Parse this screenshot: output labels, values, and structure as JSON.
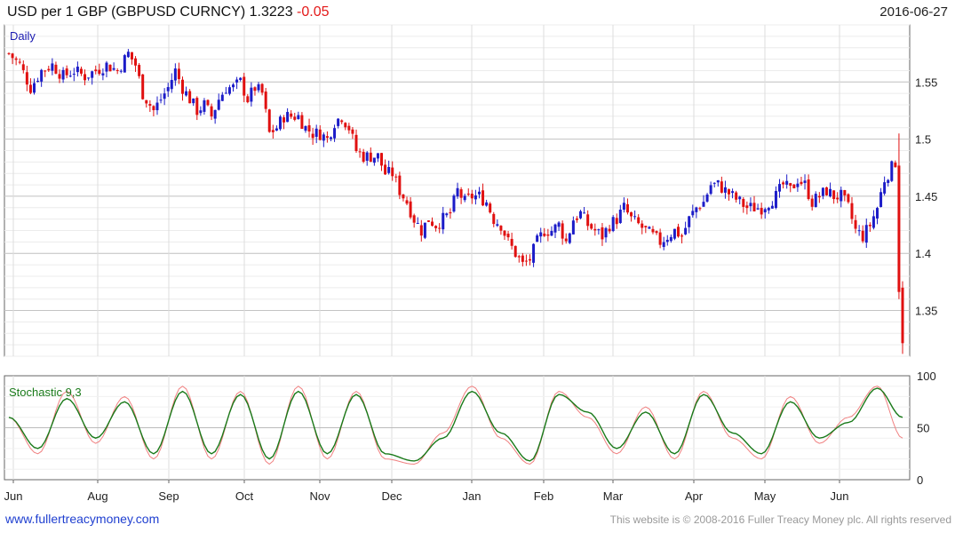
{
  "header": {
    "title": "USD per 1 GBP (GBPUSD CURNCY) 1.3223",
    "change": "-0.05",
    "date": "2016-06-27"
  },
  "footer": {
    "site": "www.fullertreacymoney.com",
    "copyright": "This website is © 2008-2016 Fuller Treacy Money plc. All rights reserved"
  },
  "colors": {
    "up": "#1c1cc8",
    "down": "#e01010",
    "stoch_k": "#f08080",
    "stoch_d": "#1a7a1a",
    "label": "#1a1ab0"
  },
  "chart_data": [
    {
      "type": "candlestick",
      "label": "Daily",
      "ylim": [
        1.31,
        1.6
      ],
      "yticks": [
        1.35,
        1.4,
        1.45,
        1.5,
        1.55
      ],
      "xticks": [
        "Jun",
        "Aug",
        "Sep",
        "Oct",
        "Nov",
        "Dec",
        "Jan",
        "Feb",
        "Mar",
        "Apr",
        "May",
        "Jun"
      ],
      "grid": true,
      "close_path": [
        [
          0,
          1.575
        ],
        [
          3,
          1.565
        ],
        [
          6,
          1.545
        ],
        [
          9,
          1.56
        ],
        [
          12,
          1.565
        ],
        [
          15,
          1.555
        ],
        [
          18,
          1.56
        ],
        [
          21,
          1.555
        ],
        [
          24,
          1.56
        ],
        [
          27,
          1.565
        ],
        [
          30,
          1.56
        ],
        [
          33,
          1.575
        ],
        [
          35,
          1.565
        ],
        [
          37,
          1.54
        ],
        [
          40,
          1.525
        ],
        [
          42,
          1.535
        ],
        [
          44,
          1.545
        ],
        [
          46,
          1.56
        ],
        [
          48,
          1.545
        ],
        [
          50,
          1.535
        ],
        [
          52,
          1.525
        ],
        [
          54,
          1.53
        ],
        [
          56,
          1.52
        ],
        [
          58,
          1.535
        ],
        [
          60,
          1.545
        ],
        [
          62,
          1.545
        ],
        [
          64,
          1.55
        ],
        [
          66,
          1.535
        ],
        [
          68,
          1.545
        ],
        [
          70,
          1.54
        ],
        [
          72,
          1.505
        ],
        [
          74,
          1.51
        ],
        [
          76,
          1.52
        ],
        [
          78,
          1.52
        ],
        [
          80,
          1.52
        ],
        [
          82,
          1.51
        ],
        [
          84,
          1.505
        ],
        [
          86,
          1.505
        ],
        [
          88,
          1.5
        ],
        [
          90,
          1.515
        ],
        [
          92,
          1.52
        ],
        [
          94,
          1.51
        ],
        [
          96,
          1.49
        ],
        [
          98,
          1.485
        ],
        [
          100,
          1.485
        ],
        [
          102,
          1.485
        ],
        [
          104,
          1.47
        ],
        [
          106,
          1.47
        ],
        [
          108,
          1.455
        ],
        [
          110,
          1.445
        ],
        [
          112,
          1.43
        ],
        [
          114,
          1.42
        ],
        [
          116,
          1.43
        ],
        [
          118,
          1.425
        ],
        [
          120,
          1.43
        ],
        [
          122,
          1.435
        ],
        [
          124,
          1.455
        ],
        [
          126,
          1.445
        ],
        [
          128,
          1.45
        ],
        [
          130,
          1.45
        ],
        [
          132,
          1.445
        ],
        [
          134,
          1.43
        ],
        [
          136,
          1.425
        ],
        [
          138,
          1.41
        ],
        [
          140,
          1.4
        ],
        [
          142,
          1.39
        ],
        [
          144,
          1.395
        ],
        [
          146,
          1.41
        ],
        [
          148,
          1.42
        ],
        [
          150,
          1.42
        ],
        [
          152,
          1.425
        ],
        [
          154,
          1.41
        ],
        [
          156,
          1.43
        ],
        [
          158,
          1.435
        ],
        [
          160,
          1.425
        ],
        [
          162,
          1.42
        ],
        [
          164,
          1.415
        ],
        [
          166,
          1.425
        ],
        [
          168,
          1.43
        ],
        [
          170,
          1.44
        ],
        [
          172,
          1.43
        ],
        [
          174,
          1.425
        ],
        [
          176,
          1.42
        ],
        [
          178,
          1.415
        ],
        [
          180,
          1.41
        ],
        [
          182,
          1.415
        ],
        [
          184,
          1.42
        ],
        [
          186,
          1.415
        ],
        [
          188,
          1.43
        ],
        [
          190,
          1.44
        ],
        [
          192,
          1.445
        ],
        [
          194,
          1.46
        ],
        [
          196,
          1.46
        ],
        [
          198,
          1.455
        ],
        [
          200,
          1.45
        ],
        [
          202,
          1.445
        ],
        [
          204,
          1.44
        ],
        [
          206,
          1.44
        ],
        [
          208,
          1.44
        ],
        [
          210,
          1.445
        ],
        [
          212,
          1.45
        ],
        [
          214,
          1.46
        ],
        [
          216,
          1.455
        ],
        [
          218,
          1.465
        ],
        [
          220,
          1.46
        ],
        [
          222,
          1.445
        ],
        [
          224,
          1.45
        ],
        [
          226,
          1.455
        ],
        [
          228,
          1.45
        ],
        [
          230,
          1.45
        ],
        [
          232,
          1.44
        ],
        [
          234,
          1.42
        ],
        [
          236,
          1.415
        ],
        [
          238,
          1.425
        ],
        [
          240,
          1.44
        ],
        [
          242,
          1.465
        ],
        [
          244,
          1.475
        ],
        [
          245,
          1.48
        ],
        [
          246,
          1.37
        ],
        [
          247,
          1.325
        ]
      ]
    },
    {
      "type": "line",
      "label": "Stochastic 9,3",
      "ylim": [
        0,
        100
      ],
      "yticks": [
        0,
        50,
        100
      ],
      "series": [
        {
          "name": "%K",
          "x": [
            0,
            8,
            16,
            24,
            32,
            40,
            48,
            56,
            64,
            72,
            80,
            88,
            96,
            104,
            112,
            120,
            128,
            136,
            144,
            152,
            160,
            168,
            176,
            184,
            192,
            200,
            208,
            216,
            224,
            232,
            240,
            247
          ],
          "values": [
            60,
            25,
            85,
            35,
            80,
            20,
            90,
            20,
            85,
            15,
            90,
            20,
            85,
            20,
            15,
            45,
            90,
            40,
            15,
            85,
            60,
            25,
            70,
            20,
            85,
            40,
            20,
            80,
            35,
            60,
            90,
            40
          ]
        },
        {
          "name": "%D",
          "x": [
            0,
            8,
            16,
            24,
            32,
            40,
            48,
            56,
            64,
            72,
            80,
            88,
            96,
            104,
            112,
            120,
            128,
            136,
            144,
            152,
            160,
            168,
            176,
            184,
            192,
            200,
            208,
            216,
            224,
            232,
            240,
            247
          ],
          "values": [
            60,
            30,
            78,
            40,
            75,
            25,
            85,
            25,
            82,
            20,
            85,
            25,
            82,
            25,
            18,
            40,
            85,
            45,
            18,
            82,
            65,
            30,
            65,
            25,
            82,
            45,
            25,
            75,
            40,
            55,
            88,
            60
          ]
        }
      ]
    }
  ]
}
